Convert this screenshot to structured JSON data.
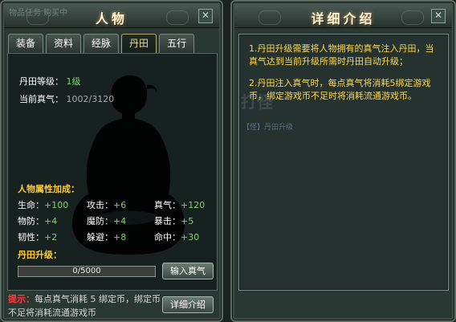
{
  "left_panel": {
    "ghost_title": "物品任务 购买中",
    "title": "人物",
    "tabs": [
      {
        "label": "装备",
        "active": false
      },
      {
        "label": "资料",
        "active": false
      },
      {
        "label": "经脉",
        "active": false
      },
      {
        "label": "丹田",
        "active": true
      },
      {
        "label": "五行",
        "active": false
      }
    ],
    "dantian": {
      "level_label": "丹田等级：",
      "level_value": "1级",
      "qi_label": "当前真气：",
      "qi_value": "1002/3120"
    },
    "attributes_title": "人物属性加成：",
    "stats": [
      {
        "label": "生命：",
        "value": "+100"
      },
      {
        "label": "攻击：",
        "value": "+6"
      },
      {
        "label": "真气：",
        "value": "+120"
      },
      {
        "label": "物防：",
        "value": "+4"
      },
      {
        "label": "魔防：",
        "value": "+4"
      },
      {
        "label": "暴击：",
        "value": "+5"
      },
      {
        "label": "韧性：",
        "value": "+2"
      },
      {
        "label": "躲避：",
        "value": "+8"
      },
      {
        "label": "命中：",
        "value": "+30"
      }
    ],
    "upgrade_title": "丹田升级：",
    "progress": {
      "text": "0/5000",
      "fraction": 0
    },
    "input_button": "输入真气",
    "hint_label": "提示：",
    "hint_text": "每点真气消耗 5 绑定币，绑定币不足将消耗流通游戏币",
    "detail_button": "详细介绍"
  },
  "right_panel": {
    "title": "详细介绍",
    "details": [
      "1.丹田升级需要将人物拥有的真气注入丹田，当真气达到当前升级所需时丹田自动升级；",
      "2.丹田注入真气时，每点真气将消耗5绑定游戏币，绑定游戏币不足时将消耗流通游戏币。"
    ],
    "watermark": "打怪",
    "small_watermark": "【怪】丹田升级"
  },
  "close_icon": "✕"
}
